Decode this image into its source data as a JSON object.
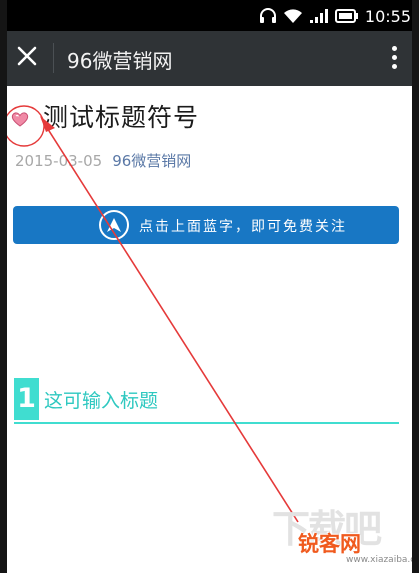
{
  "status_bar": {
    "time": "10:55",
    "icons": [
      "headphones-icon",
      "wifi-icon",
      "signal-icon",
      "battery-icon"
    ]
  },
  "app_bar": {
    "title": "96微营销网",
    "close_icon": "close-icon",
    "more_icon": "more-vertical-icon",
    "background": "#2f3336"
  },
  "article": {
    "title": "测试标题符号",
    "date": "2015-03-05",
    "account": "96微营销网",
    "banner": {
      "text": "点击上面蓝字，即可免费关注",
      "color": "#1877c4",
      "icon": "arrow-up-logo-icon"
    },
    "section": {
      "number": "1",
      "title": "这可输入标题",
      "color": "#40ddd0"
    }
  },
  "annotation": {
    "color": "#e53a3a",
    "shapes": [
      "circle",
      "arrow"
    ]
  },
  "watermark": {
    "back": "下载吧",
    "front": "锐客网",
    "url": "www.xiazaiba.com"
  }
}
